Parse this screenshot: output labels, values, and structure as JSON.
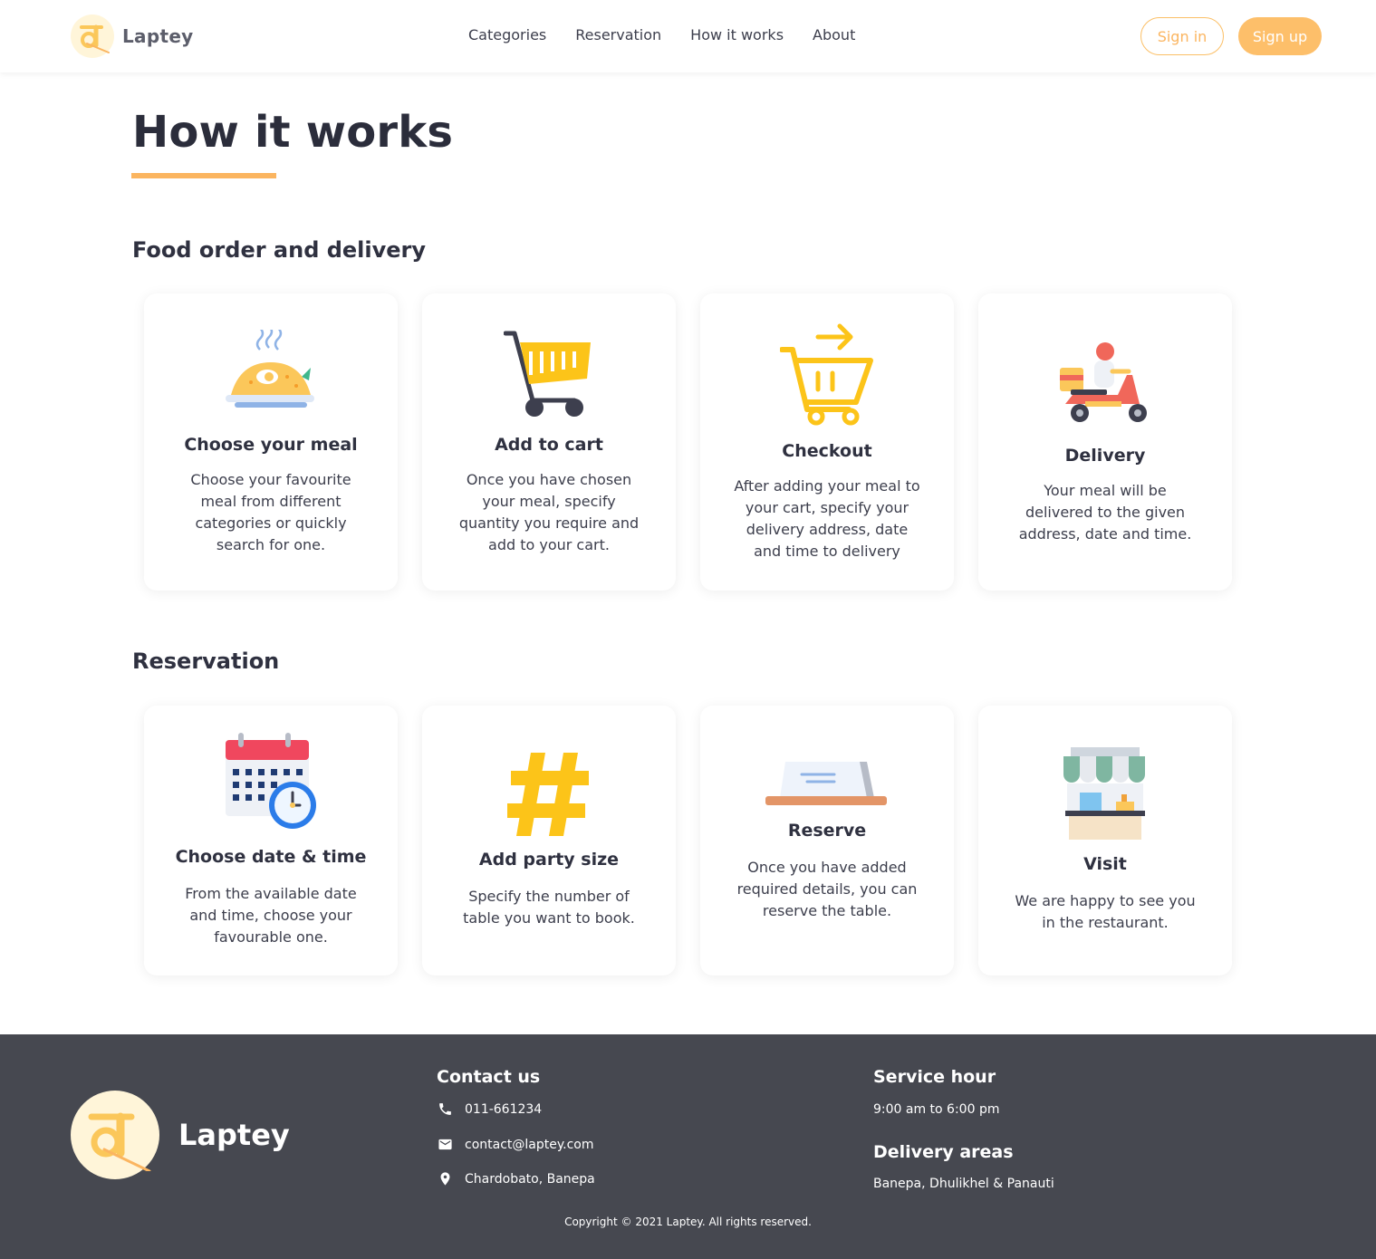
{
  "brand": {
    "name": "Laptey",
    "logo_glyph": "द",
    "colors": {
      "accent": "#fbb560",
      "footer_bg": "#464850",
      "text": "#2f3140"
    }
  },
  "nav": {
    "items": [
      "Categories",
      "Reservation",
      "How it works",
      "About"
    ]
  },
  "auth": {
    "signin": "Sign in",
    "signup": "Sign up"
  },
  "page": {
    "title": "How it works"
  },
  "sections": [
    {
      "title": "Food order and delivery",
      "cards": [
        {
          "icon": "meal-plate-icon",
          "title": "Choose your meal",
          "desc": "Choose your favourite meal from different categories or quickly search for one."
        },
        {
          "icon": "shopping-cart-icon",
          "title": "Add to cart",
          "desc": "Once you have chosen your meal, specify quantity you require and add to your cart."
        },
        {
          "icon": "checkout-cart-icon",
          "title": "Checkout",
          "desc": "After adding your meal to your cart, specify your delivery address, date and time to delivery"
        },
        {
          "icon": "delivery-scooter-icon",
          "title": "Delivery",
          "desc": "Your meal will be delivered to the given address, date and time."
        }
      ]
    },
    {
      "title": "Reservation",
      "cards": [
        {
          "icon": "calendar-clock-icon",
          "title": "Choose date & time",
          "desc": "From the available date and time, choose your favourable one."
        },
        {
          "icon": "hashtag-icon",
          "title": "Add party size",
          "desc": "Specify the number of table you want to book."
        },
        {
          "icon": "reserved-sign-icon",
          "title": "Reserve",
          "desc": "Once you have added required details, you can reserve the table."
        },
        {
          "icon": "restaurant-stall-icon",
          "title": "Visit",
          "desc": "We are happy to see you in the restaurant."
        }
      ]
    }
  ],
  "footer": {
    "contact_title": "Contact us",
    "phone": "011-661234",
    "email": "contact@laptey.com",
    "address": "Chardobato, Banepa",
    "service_title": "Service hour",
    "service_hours": "9:00 am to 6:00 pm",
    "delivery_title": "Delivery areas",
    "delivery_areas": "Banepa, Dhulikhel & Panauti",
    "copyright": "Copyright © 2021 Laptey. All rights reserved."
  }
}
